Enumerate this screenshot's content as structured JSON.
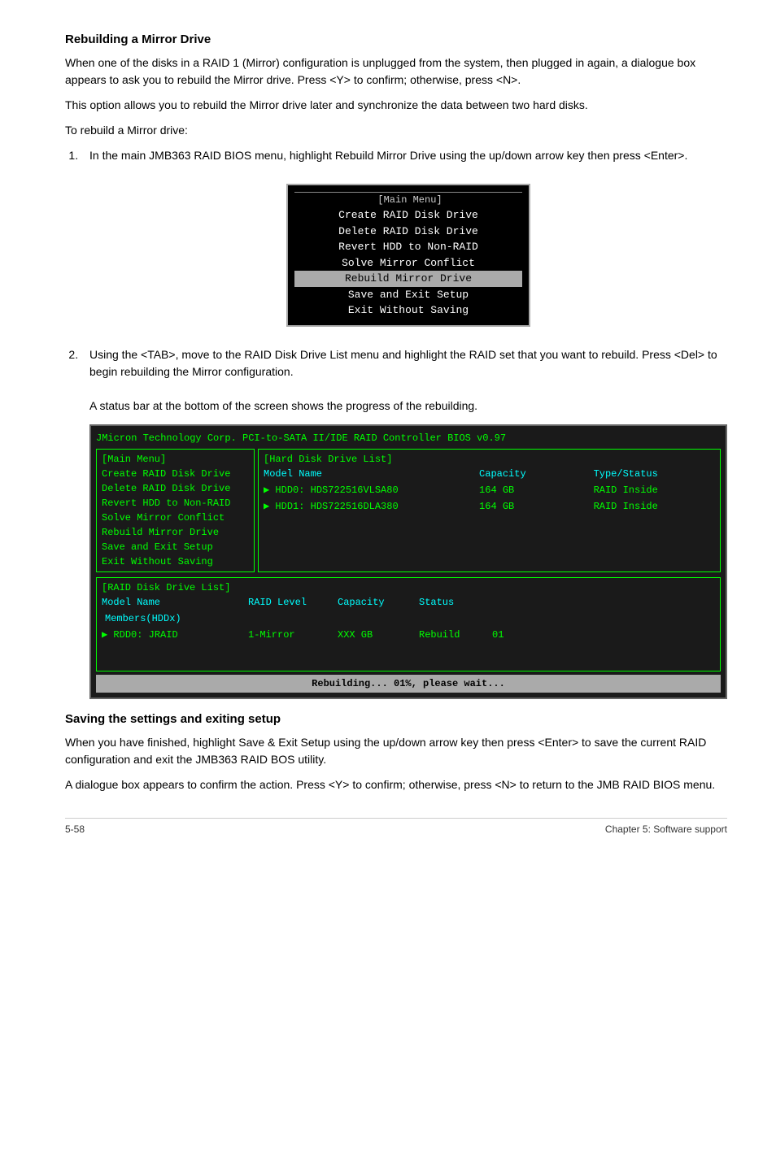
{
  "page": {
    "section1_title": "Rebuilding a Mirror Drive",
    "section1_para1": "When one of the disks in a RAID 1 (Mirror) configuration is unplugged from the system, then plugged in again, a dialogue box appears to ask you to rebuild the Mirror drive. Press <Y> to confirm; otherwise, press <N>.",
    "section1_para2": "This option allows you to rebuild the Mirror drive later and synchronize the data between two hard disks.",
    "section1_para3": "To rebuild a Mirror drive:",
    "step1_text": "In the main JMB363 RAID BIOS menu, highlight Rebuild Mirror Drive using the up/down arrow key then press <Enter>.",
    "step2_text": "Using the <TAB>, move to the RAID Disk Drive List menu and highlight the RAID set that you want to rebuild. Press <Del> to begin rebuilding the Mirror configuration.",
    "step2_note": "A status bar at the bottom of the screen shows the progress of the rebuilding.",
    "section2_title": "Saving the settings and exiting setup",
    "section2_para1": "When you have finished, highlight Save & Exit Setup using the up/down arrow key then press <Enter> to save the current RAID configuration and exit the JMB363 RAID BOS utility.",
    "section2_para2": "A dialogue box appears to confirm the action. Press <Y> to confirm; otherwise, press <N> to return to the JMB RAID BIOS menu.",
    "footer_left": "5-58",
    "footer_right": "Chapter 5: Software support",
    "main_menu_title": "[Main Menu]",
    "main_menu_items": [
      "Create RAID Disk Drive",
      "Delete RAID Disk Drive",
      "Revert HDD to Non-RAID",
      "Solve Mirror Conflict",
      "Rebuild Mirror Drive",
      "Save and Exit Setup",
      "Exit Without Saving"
    ],
    "main_menu_highlight": "Rebuild Mirror Drive",
    "bios_header": "JMicron Technology Corp.  PCI-to-SATA II/IDE RAID Controller BIOS v0.97",
    "bios_left_title": "[Main Menu]",
    "bios_left_items": [
      "Create RAID Disk Drive",
      "Delete RAID Disk Drive",
      "Revert HDD to Non-RAID",
      "Solve Mirror Conflict",
      "Rebuild Mirror Drive",
      "Save and Exit Setup",
      "Exit Without Saving"
    ],
    "bios_right_title": "[Hard Disk Drive List]",
    "bios_right_col1": "Model Name",
    "bios_right_col2": "Capacity",
    "bios_right_col3": "Type/Status",
    "bios_disks": [
      {
        "arrow": "▶",
        "name": "HDD0: HDS722516VLSA80",
        "capacity": "164 GB",
        "type": "RAID Inside"
      },
      {
        "arrow": "▶",
        "name": "HDD1: HDS722516DLA380",
        "capacity": "164 GB",
        "type": "RAID Inside"
      }
    ],
    "raid_list_title": "[RAID Disk Drive List]",
    "raid_col1": "Model Name",
    "raid_col2": "RAID Level",
    "raid_col3": "Capacity",
    "raid_col4": "Status",
    "raid_col5": "Members(HDDx)",
    "raid_entries": [
      {
        "arrow": "▶",
        "name": "RDD0:  JRAID",
        "level": "1-Mirror",
        "capacity": "XXX GB",
        "status": "Rebuild",
        "members": "01"
      }
    ],
    "status_bar": "Rebuilding... 01%, please wait..."
  }
}
